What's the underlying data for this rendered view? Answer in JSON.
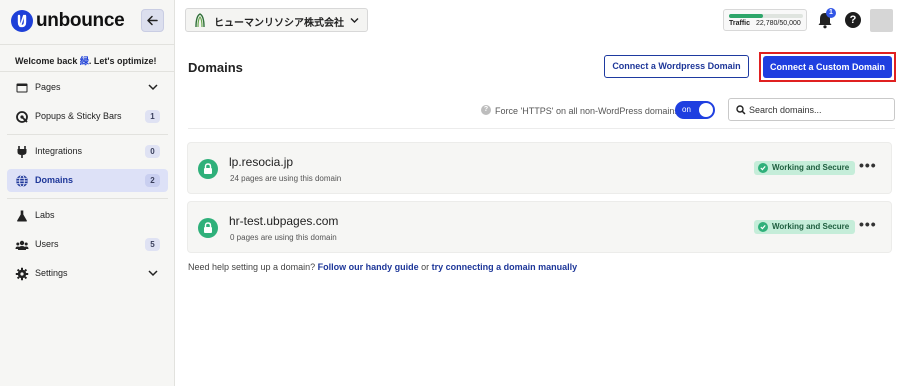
{
  "app": {
    "name": "unbounce"
  },
  "sidebar": {
    "welcome_prefix": "Welcome back ",
    "welcome_name": "緑",
    "welcome_suffix": ". Let's optimize!",
    "items": [
      {
        "label": "Pages",
        "icon": "pages-icon",
        "chevron": true
      },
      {
        "label": "Popups & Sticky Bars",
        "icon": "popups-icon",
        "badge": "1"
      },
      {
        "label": "Integrations",
        "icon": "plug-icon",
        "badge": "0"
      },
      {
        "label": "Domains",
        "icon": "globe-icon",
        "badge": "2",
        "active": true
      },
      {
        "label": "Labs",
        "icon": "flask-icon"
      },
      {
        "label": "Users",
        "icon": "users-icon",
        "badge": "5"
      },
      {
        "label": "Settings",
        "icon": "gear-icon",
        "chevron": true
      }
    ]
  },
  "topbar": {
    "workspace_name": "ヒューマンリソシア株式会社",
    "traffic_label": "Traffic",
    "traffic_value": "22,780/50,000",
    "traffic_fraction": 0.4556,
    "notification_count": "1",
    "help_label": "?"
  },
  "main": {
    "title": "Domains",
    "connect_wordpress_label": "Connect a Wordpress Domain",
    "connect_custom_label": "Connect a Custom Domain",
    "force_https_label": "Force 'HTTPS' on all non-WordPress domains",
    "toggle_label": "on",
    "search_placeholder": "Search domains...",
    "domains": [
      {
        "name": "lp.resocia.jp",
        "pages": "24 pages are using this domain",
        "status": "Working and Secure"
      },
      {
        "name": "hr-test.ubpages.com",
        "pages": "0 pages are using this domain",
        "status": "Working and Secure"
      }
    ],
    "help_prefix": "Need help setting up a domain? ",
    "help_link1": "Follow our handy guide",
    "help_mid": " or ",
    "help_link2": "try connecting a domain manually"
  },
  "colors": {
    "accent": "#1f3fe0",
    "success": "#2fb07a",
    "highlight_border": "#e02020",
    "sidebar_bg": "#f6f6f4"
  }
}
